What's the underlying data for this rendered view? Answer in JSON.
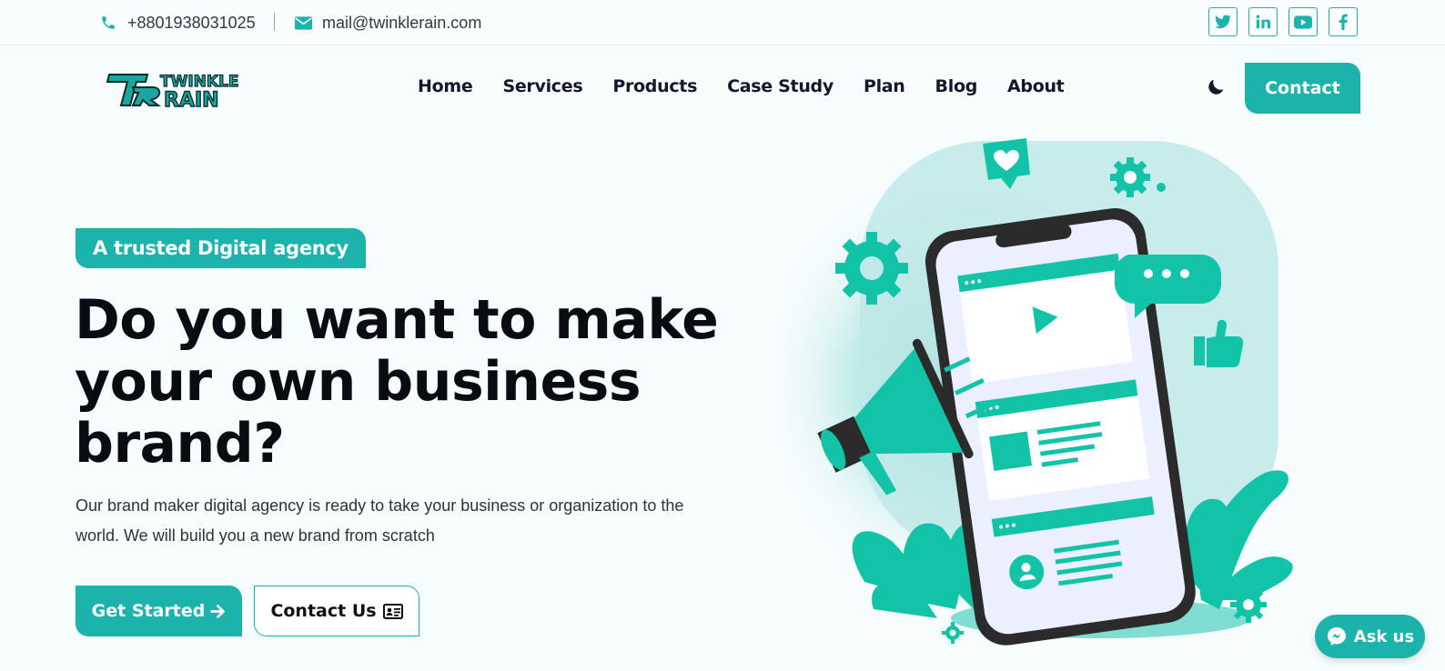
{
  "topbar": {
    "phone": "+8801938031025",
    "email": "mail@twinklerain.com",
    "social": [
      "twitter-icon",
      "linkedin-icon",
      "youtube-icon",
      "facebook-icon"
    ]
  },
  "brand": {
    "logo_line1": "TWINKLE",
    "logo_line2": "RAIN",
    "logo_mark": "TR"
  },
  "nav": {
    "items": [
      "Home",
      "Services",
      "Products",
      "Case Study",
      "Plan",
      "Blog",
      "About"
    ],
    "contact_label": "Contact"
  },
  "hero": {
    "badge": "A trusted Digital agency",
    "headline_line1": "Do you want to make",
    "headline_line2": "your own business",
    "headline_line3": "brand?",
    "description": "Our brand maker digital agency is ready to take your business or organization to the world. We will build you a new brand from scratch",
    "primary_cta": "Get Started",
    "secondary_cta": "Contact Us"
  },
  "chat": {
    "label": "Ask us"
  },
  "colors": {
    "accent": "#1db3ad",
    "illustration": "#12c3a8",
    "dark": "#15172a"
  }
}
